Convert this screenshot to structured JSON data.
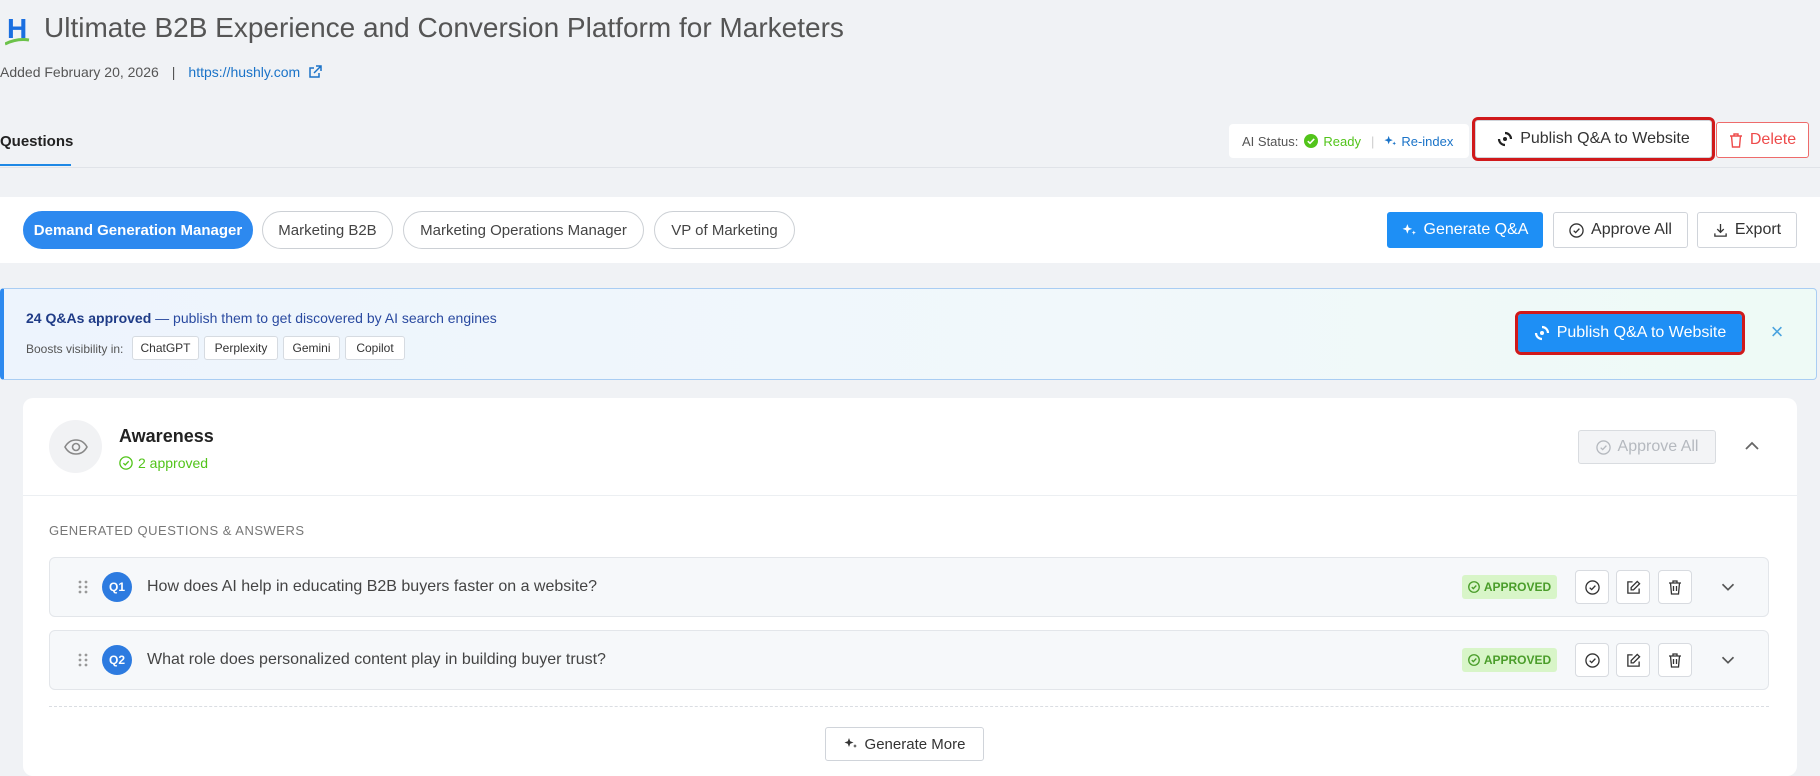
{
  "header": {
    "logo_letter": "H",
    "title": "Ultimate B2B Experience and Conversion Platform for Marketers",
    "added": "Added February 20, 2026",
    "separator": "|",
    "url": "https://hushly.com"
  },
  "tabs": {
    "questions": "Questions"
  },
  "ai_status": {
    "label": "AI Status:",
    "value": "Ready",
    "reindex": "Re-index"
  },
  "actions": {
    "publish": "Publish Q&A to Website",
    "delete": "Delete"
  },
  "personas": [
    {
      "label": "Demand Generation Manager",
      "active": true
    },
    {
      "label": "Marketing B2B",
      "active": false
    },
    {
      "label": "Marketing Operations Manager",
      "active": false
    },
    {
      "label": "VP of Marketing",
      "active": false
    }
  ],
  "toolbar": {
    "generate": "Generate Q&A",
    "approve_all": "Approve All",
    "export": "Export"
  },
  "banner": {
    "count": "24 Q&As approved",
    "message": " — publish them to get discovered by AI search engines",
    "boost_label": "Boosts visibility in:",
    "engines": [
      "ChatGPT",
      "Perplexity",
      "Gemini",
      "Copilot"
    ],
    "publish": "Publish Q&A to Website",
    "close": "×"
  },
  "section": {
    "title": "Awareness",
    "approved": "2 approved",
    "approve_all": "Approve All",
    "list_heading": "GENERATED QUESTIONS & ANSWERS",
    "generate_more": "Generate More",
    "questions": [
      {
        "num": "Q1",
        "text": "How does AI help in educating B2B buyers faster on a website?",
        "status": "APPROVED"
      },
      {
        "num": "Q2",
        "text": "What role does personalized content play in building buyer trust?",
        "status": "APPROVED"
      }
    ]
  },
  "colors": {
    "accent": "#1e8ff5",
    "approved_green": "#52c41a",
    "danger": "#ee4b4b",
    "highlight_red": "#d0191b"
  }
}
